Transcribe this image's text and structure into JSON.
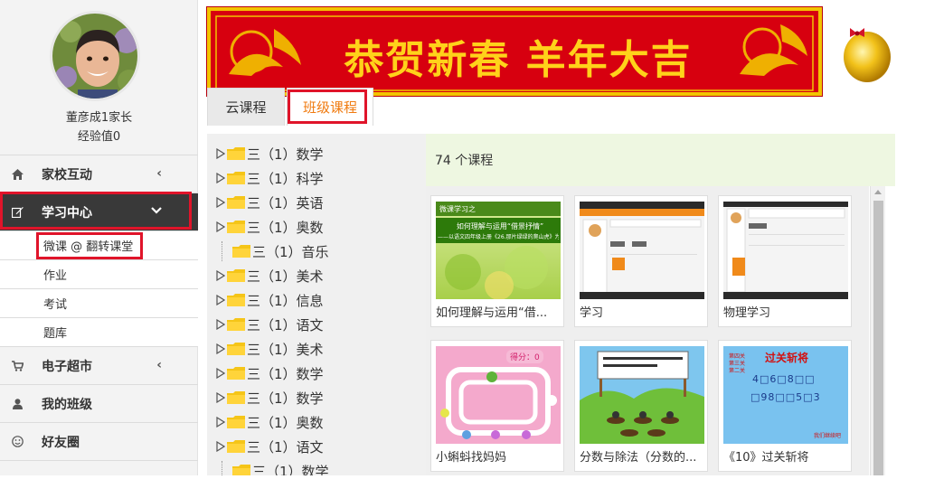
{
  "user": {
    "name": "董彦成1家长",
    "experience": "经验值0"
  },
  "nav": {
    "home_school": "家校互动",
    "study_center": "学习中心",
    "sub_items": [
      "微课 @ 翻转课堂",
      "作业",
      "考试",
      "题库"
    ],
    "e_market": "电子超市",
    "my_class": "我的班级",
    "friends": "好友圈"
  },
  "banner": {
    "text": "恭贺新春 羊年大吉"
  },
  "tabs": {
    "cloud": "云课程",
    "class": "班级课程"
  },
  "tree": {
    "items": [
      {
        "label": "三（1）数学",
        "arrow": true
      },
      {
        "label": "三（1）科学",
        "arrow": true
      },
      {
        "label": "三（1）英语",
        "arrow": true
      },
      {
        "label": "三（1）奥数",
        "arrow": true
      },
      {
        "label": "三（1）音乐",
        "arrow": false
      },
      {
        "label": "三（1）美术",
        "arrow": true
      },
      {
        "label": "三（1）信息",
        "arrow": true
      },
      {
        "label": "三（1）语文",
        "arrow": true
      },
      {
        "label": "三（1）美术",
        "arrow": true
      },
      {
        "label": "三（1）数学",
        "arrow": true
      },
      {
        "label": "三（1）数学",
        "arrow": true
      },
      {
        "label": "三（1）奥数",
        "arrow": true
      },
      {
        "label": "三（1）语文",
        "arrow": true
      },
      {
        "label": "三（1）数学",
        "arrow": false
      }
    ]
  },
  "courses": {
    "count_text": "74 个课程",
    "cards": [
      {
        "title": "如何理解与运用“借..."
      },
      {
        "title": "学习"
      },
      {
        "title": "物理学习"
      },
      {
        "title": "小蝌蚪找妈妈"
      },
      {
        "title": "分数与除法（分数的..."
      },
      {
        "title": "《10》过关斩将"
      }
    ],
    "thumb1": {
      "header": "微课学习之",
      "line1": "如何理解与运用“借景抒情”",
      "line2": "——以语文四年级上册《26.那片绿绿的爬山虎》为例"
    },
    "thumb4": {
      "score": "得分：0"
    },
    "thumb6": {
      "title": "过关斩将",
      "left_lines": [
        "第四关",
        "第三关",
        "第二关"
      ],
      "row1": "4□6□8□□",
      "row2": "□98□□5□3",
      "footer": "我们继续吧"
    }
  },
  "colors": {
    "accent": "#f07b10",
    "highlight": "#e0142a",
    "banner": "#d7000f",
    "nav_active": "#393939"
  }
}
